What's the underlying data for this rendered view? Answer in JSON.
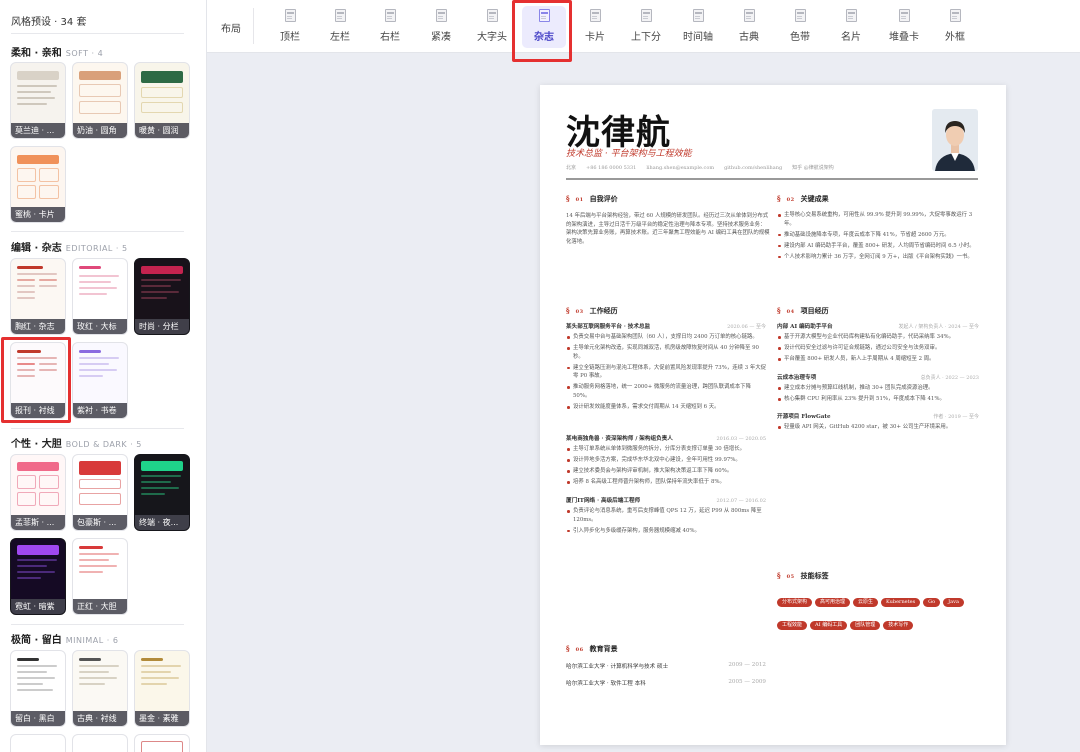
{
  "sidebar": {
    "header": "风格预设 · 34 套",
    "sections": [
      {
        "title": "柔和 · 亲和",
        "en": "SOFT · 4",
        "cards": [
          "莫兰迪 · ...",
          "奶油 · 圆角",
          "暖黄 · 圆润",
          "蜜桃 · 卡片"
        ]
      },
      {
        "title": "编辑 · 杂志",
        "en": "EDITORIAL · 5",
        "cards": [
          "胸红 · 杂志",
          "玫红 · 大标",
          "时尚 · 分栏",
          "报刊 · 衬线",
          "紫衬 · 书卷"
        ]
      },
      {
        "title": "个性 · 大胆",
        "en": "BOLD & DARK · 5",
        "cards": [
          "孟菲斯 · ...",
          "包豪斯 · ...",
          "终端 · 夜...",
          "霓虹 · 暗紫",
          "正红 · 大胆"
        ]
      },
      {
        "title": "极简 · 留白",
        "en": "MINIMAL · 6",
        "cards": [
          "留白 · 黑白",
          "古典 · 衬线",
          "墨金 · 素雅"
        ]
      }
    ]
  },
  "toolbar": {
    "label": "布局",
    "buttons": [
      "顶栏",
      "左栏",
      "右栏",
      "紧凑",
      "大字头",
      "杂志",
      "卡片",
      "上下分",
      "时间轴",
      "古典",
      "色带",
      "名片",
      "堆叠卡",
      "外框"
    ],
    "active": "杂志"
  },
  "resume": {
    "name": "沈律航",
    "title": "技术总监 · 平台架构与工程效能",
    "contact": [
      "北京",
      "+86 186 0000 5331",
      "lihang.shen@example.com",
      "github.com/shenlihang",
      "知乎 @律航说架构"
    ],
    "summary": {
      "num": "01",
      "title": "自我评价",
      "text": "14 年后端与平台架构经验，带过 60 人规模的研发团队。经历过三次从单体到分布式的架构演进，主导过日活千万级平台的稳定性治理与降本专项。坚持技术服务业务：架构决策先算业务账，再算技术账。近三年聚焦工程效能与 AI 编码工具在团队的规模化落地。"
    },
    "achievements": {
      "num": "02",
      "title": "关键成果",
      "items": [
        "主导核心交易系统重构，可用性从 99.9% 提升到 99.99%，大促零事故运行 3 年。",
        "推动基础设施降本专项，年度云成本下降 41%，节省超 2600 万元。",
        "建设内部 AI 编码助手平台，覆盖 800+ 研发，人均周节省编码时间 6.5 小时。",
        "个人技术影响力累计 36 万字，全网订阅 9 万+，出版《平台架构实践》一书。"
      ]
    },
    "experience": {
      "num": "03",
      "title": "工作经历",
      "jobs": [
        {
          "co": "某头部互联网服务平台 · 技术总监",
          "date": "2020.06 — 至今",
          "items": [
            "负责交易中台与基础架构团队（60 人），支撑日均 2400 万订单的核心链路。",
            "主导单元化架构改造，实现同城双活，机房级故障恢复时间从 40 分钟降至 90 秒。",
            "建立全链路压测与混沌工程体系，大促前置风险发现率提升 73%，连续 3 年大促零 P0 事故。",
            "推动服务网格落地，统一 2000+ 微服务的流量治理，跨团队联调成本下降 50%。",
            "设计研发效能度量体系，需求交付周期从 14 天缩短到 6 天。"
          ]
        },
        {
          "co": "某电商独角兽 · 资深架构师 / 架构组负责人",
          "date": "2016.03 — 2020.05",
          "items": [
            "主导订单系统从单体到微服务的拆分，分库分表支撑订单量 30 倍增长。",
            "设计异地多活方案，完成华东华北双中心建设，全年可用性 99.97%。",
            "建立技术委员会与架构评审机制，推大架构决策返工率下降 60%。",
            "培养 8 名高级工程师晋升架构师，团队保持年流失率低于 8%。"
          ]
        },
        {
          "co": "厦门IT网络 · 高级后端工程师",
          "date": "2012.07 — 2016.02",
          "items": [
            "负责评论与消息系统，重写后支撑峰值 QPS 12 万，延迟 P99 从 800ms 降至 120ms。",
            "引入异步化与多级缓存架构，服务器规模缩减 40%。"
          ]
        }
      ]
    },
    "projects": {
      "num": "04",
      "title": "项目经历",
      "list": [
        {
          "name": "内部 AI 编码助手平台",
          "date": "发起人 / 架构负责人 · 2024 — 至今",
          "items": [
            "基于开源大模型与企业代码库构建私有化编码助手，代码采纳率 34%。",
            "设计代码安全过滤与许可证合规链路，通过公司安全与法务双审。",
            "平台覆盖 800+ 研发人员，新人上手周期从 4 周缩短至 2 周。"
          ]
        },
        {
          "name": "云成本治理专项",
          "date": "总负责人 · 2022 — 2023",
          "items": [
            "建立成本分摊与预算红线机制，推动 30+ 团队完成资源治理。",
            "核心集群 CPU 利用率从 23% 提升到 51%，年度成本下降 41%。"
          ]
        },
        {
          "name": "开源项目 FlowGate",
          "date": "作者 · 2019 — 至今",
          "items": [
            "轻量级 API 网关，GitHub 4200 star，被 30+ 公司生产环境采用。"
          ]
        }
      ]
    },
    "skills": {
      "num": "05",
      "title": "技能标签",
      "tags": [
        "分布式架构",
        "高可用治理",
        "云原生",
        "Kubernetes",
        "Go",
        "Java",
        "工程效能",
        "AI 编码工具",
        "团队管理",
        "技术写作"
      ]
    },
    "education": {
      "num": "06",
      "title": "教育背景",
      "list": [
        {
          "school": "哈尔滨工业大学 · 计算机科学与技术 硕士",
          "date": "2009 — 2012"
        },
        {
          "school": "哈尔滨工业大学 · 软件工程 本科",
          "date": "2005 — 2009"
        }
      ]
    }
  },
  "colors": {
    "accent": "#c0392b",
    "toolbar_active_bg": "#ecebfd",
    "highlight_box": "#e53030"
  }
}
